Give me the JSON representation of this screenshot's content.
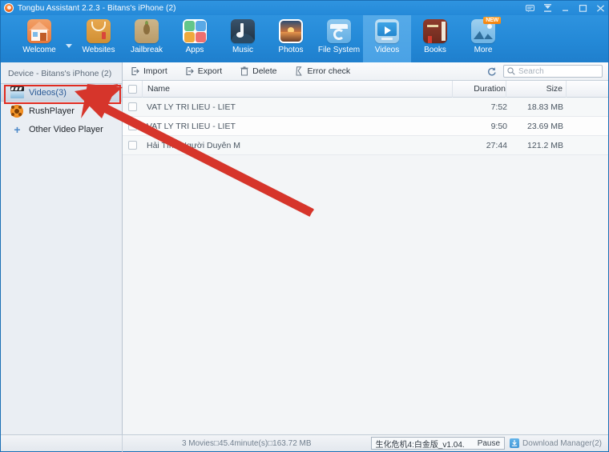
{
  "window": {
    "title": "Tongbu Assistant 2.2.3 - Bitans's iPhone (2)",
    "logo_icon": "tongbu-logo-icon",
    "controls": [
      {
        "name": "feedback-icon",
        "label": "⌨"
      },
      {
        "name": "download-icon",
        "label": "↧"
      },
      {
        "name": "minimize-icon",
        "label": "—"
      },
      {
        "name": "maximize-icon",
        "label": "□"
      },
      {
        "name": "close-icon",
        "label": "✕"
      }
    ]
  },
  "toolbar": {
    "items": [
      {
        "label": "Welcome",
        "icon": "home-icon",
        "active": false,
        "badge": ""
      },
      {
        "label": "Websites",
        "icon": "shopping-bag-icon",
        "active": false,
        "badge": ""
      },
      {
        "label": "Jailbreak",
        "icon": "pineapple-icon",
        "active": false,
        "badge": ""
      },
      {
        "label": "Apps",
        "icon": "apps-grid-icon",
        "active": false,
        "badge": ""
      },
      {
        "label": "Music",
        "icon": "music-note-icon",
        "active": false,
        "badge": ""
      },
      {
        "label": "Photos",
        "icon": "photo-icon",
        "active": false,
        "badge": ""
      },
      {
        "label": "File System",
        "icon": "file-system-icon",
        "active": false,
        "badge": ""
      },
      {
        "label": "Videos",
        "icon": "video-player-icon",
        "active": true,
        "badge": ""
      },
      {
        "label": "Books",
        "icon": "book-icon",
        "active": false,
        "badge": ""
      },
      {
        "label": "More",
        "icon": "more-image-icon",
        "active": false,
        "badge": "NEW"
      }
    ],
    "dropdown_icon": "chevron-down-icon"
  },
  "sidebar": {
    "header": "Device - Bitans's iPhone (2)",
    "items": [
      {
        "label": "Videos(3)",
        "icon": "clapperboard-icon",
        "selected": true
      },
      {
        "label": "RushPlayer",
        "icon": "rushplayer-icon",
        "selected": false
      },
      {
        "label": "Other Video Player",
        "icon": "plus-icon",
        "selected": false
      }
    ]
  },
  "content_toolbar": {
    "buttons": [
      {
        "label": "Import",
        "icon": "import-icon"
      },
      {
        "label": "Export",
        "icon": "export-icon"
      },
      {
        "label": "Delete",
        "icon": "trash-icon"
      },
      {
        "label": "Error check",
        "icon": "error-check-icon"
      }
    ],
    "refresh_icon": "refresh-icon",
    "search": {
      "icon": "search-icon",
      "value": "",
      "placeholder": "Search"
    }
  },
  "table": {
    "select_all_checkbox": false,
    "columns": {
      "name": "Name",
      "duration": "Duration",
      "size": "Size"
    },
    "rows": [
      {
        "checked": false,
        "name": "VAT LY TRI LIEU - LIET",
        "duration": "7:52",
        "size": "18.83 MB"
      },
      {
        "checked": false,
        "name": "VAT LY TRI LIEU - LIET",
        "duration": "9:50",
        "size": "23.69 MB"
      },
      {
        "checked": false,
        "name": "Hải Tình Người Duyên M",
        "duration": "27:44",
        "size": "121.2 MB"
      }
    ]
  },
  "statusbar": {
    "summary": "3 Movies⌅3□45.4minute(s)□163.72 MB",
    "summary_text": "3 Movies□45.4minute(s)□163.72 MB",
    "download_item": "生化危机4:白金版_v1.04.",
    "pause_label": "Pause",
    "download_manager_label": "Download Manager(2)",
    "download_manager_icon": "download-manager-icon"
  },
  "annotation": {
    "highlight_target": "Videos(3)",
    "arrow_color": "#d6352b",
    "rect_color": "#e02b20"
  }
}
